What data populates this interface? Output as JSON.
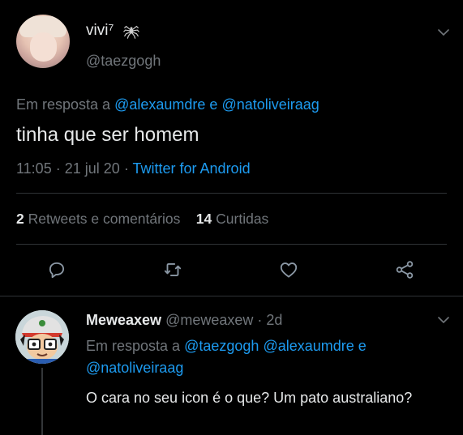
{
  "main_tweet": {
    "display_name": "vivi⁷",
    "handle": "@taezgogh",
    "reply_prefix": "Em resposta a",
    "reply_mention_1": "@alexaumdre",
    "reply_conj": "e",
    "reply_mention_2": "@natoliveiraag",
    "text": "tinha que ser homem",
    "time": "11:05",
    "date": "21 jul 20",
    "source": "Twitter for Android",
    "retweets_count": "2",
    "retweets_label": "Retweets e comentários",
    "likes_count": "14",
    "likes_label": "Curtidas",
    "separator": "·"
  },
  "reply_tweet": {
    "display_name": "Meweaxew",
    "handle": "@meweaxew",
    "time_ago": "2d",
    "separator": "·",
    "reply_prefix": "Em resposta a",
    "mention_1": "@taezgogh",
    "mention_2": "@alexaumdre",
    "conj": "e",
    "mention_3": "@natoliveiraag",
    "text": "O cara no seu icon é o que? Um pato australiano?"
  },
  "colors": {
    "background": "#000000",
    "text": "#e7e9ea",
    "muted": "#71767b",
    "accent": "#1d9bf0"
  },
  "icons": [
    "spider-icon",
    "chevron-down-icon",
    "reply-icon",
    "retweet-icon",
    "like-icon",
    "share-icon"
  ]
}
